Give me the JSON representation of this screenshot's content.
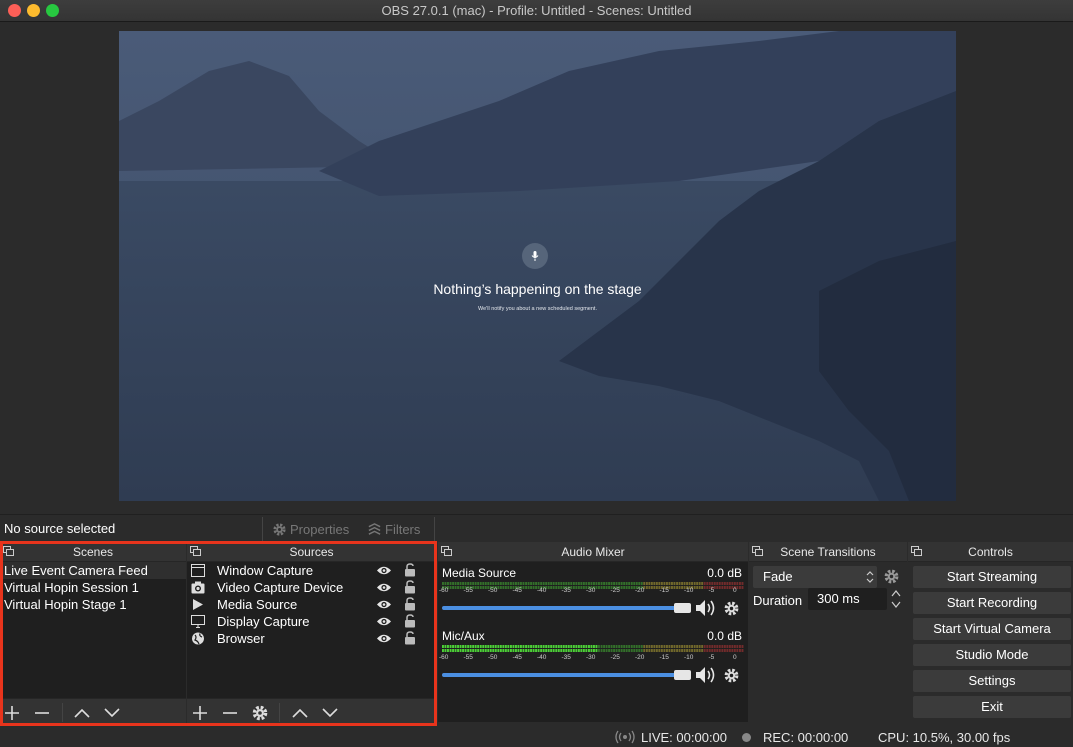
{
  "window": {
    "title": "OBS 27.0.1 (mac) - Profile: Untitled - Scenes: Untitled"
  },
  "preview": {
    "stage_title": "Nothing’s happening on the stage",
    "stage_subtitle": "We'll notify you about a new scheduled segment.",
    "mic_icon": "microphone-icon"
  },
  "source_toolbar": {
    "status": "No source selected",
    "properties_label": "Properties",
    "filters_label": "Filters"
  },
  "scenes": {
    "header": "Scenes",
    "items": [
      "Live Event  Camera Feed",
      "Virtual Hopin Session 1",
      "Virtual Hopin Stage 1"
    ],
    "selected_index": 0
  },
  "sources": {
    "header": "Sources",
    "items": [
      {
        "name": "Window Capture",
        "icon": "window-icon"
      },
      {
        "name": "Video Capture Device",
        "icon": "camera-icon"
      },
      {
        "name": "Media Source",
        "icon": "play-icon"
      },
      {
        "name": "Display Capture",
        "icon": "monitor-icon"
      },
      {
        "name": "Browser",
        "icon": "globe-icon"
      }
    ]
  },
  "audio_mixer": {
    "header": "Audio Mixer",
    "scale": [
      "-60",
      "-55",
      "-50",
      "-45",
      "-40",
      "-35",
      "-30",
      "-25",
      "-20",
      "-15",
      "-10",
      "-5",
      "0"
    ],
    "channels": [
      {
        "name": "Media Source",
        "db": "0.0 dB",
        "level": 0.0,
        "volume": 1.0
      },
      {
        "name": "Mic/Aux",
        "db": "0.0 dB",
        "level": 0.51,
        "volume": 1.0
      }
    ]
  },
  "scene_transitions": {
    "header": "Scene Transitions",
    "transition": "Fade",
    "duration_label": "Duration",
    "duration_value": "300 ms"
  },
  "controls": {
    "header": "Controls",
    "buttons": [
      "Start Streaming",
      "Start Recording",
      "Start Virtual Camera",
      "Studio Mode",
      "Settings",
      "Exit"
    ]
  },
  "status": {
    "live": "LIVE: 00:00:00",
    "rec": "REC: 00:00:00",
    "cpu": "CPU: 10.5%, 30.00 fps"
  },
  "colors": {
    "accent": "#4b8fe2",
    "highlight": "#e8341c",
    "meter_green": "#4cd137",
    "meter_yellow": "#d4c23a",
    "meter_red": "#d43a3a"
  }
}
